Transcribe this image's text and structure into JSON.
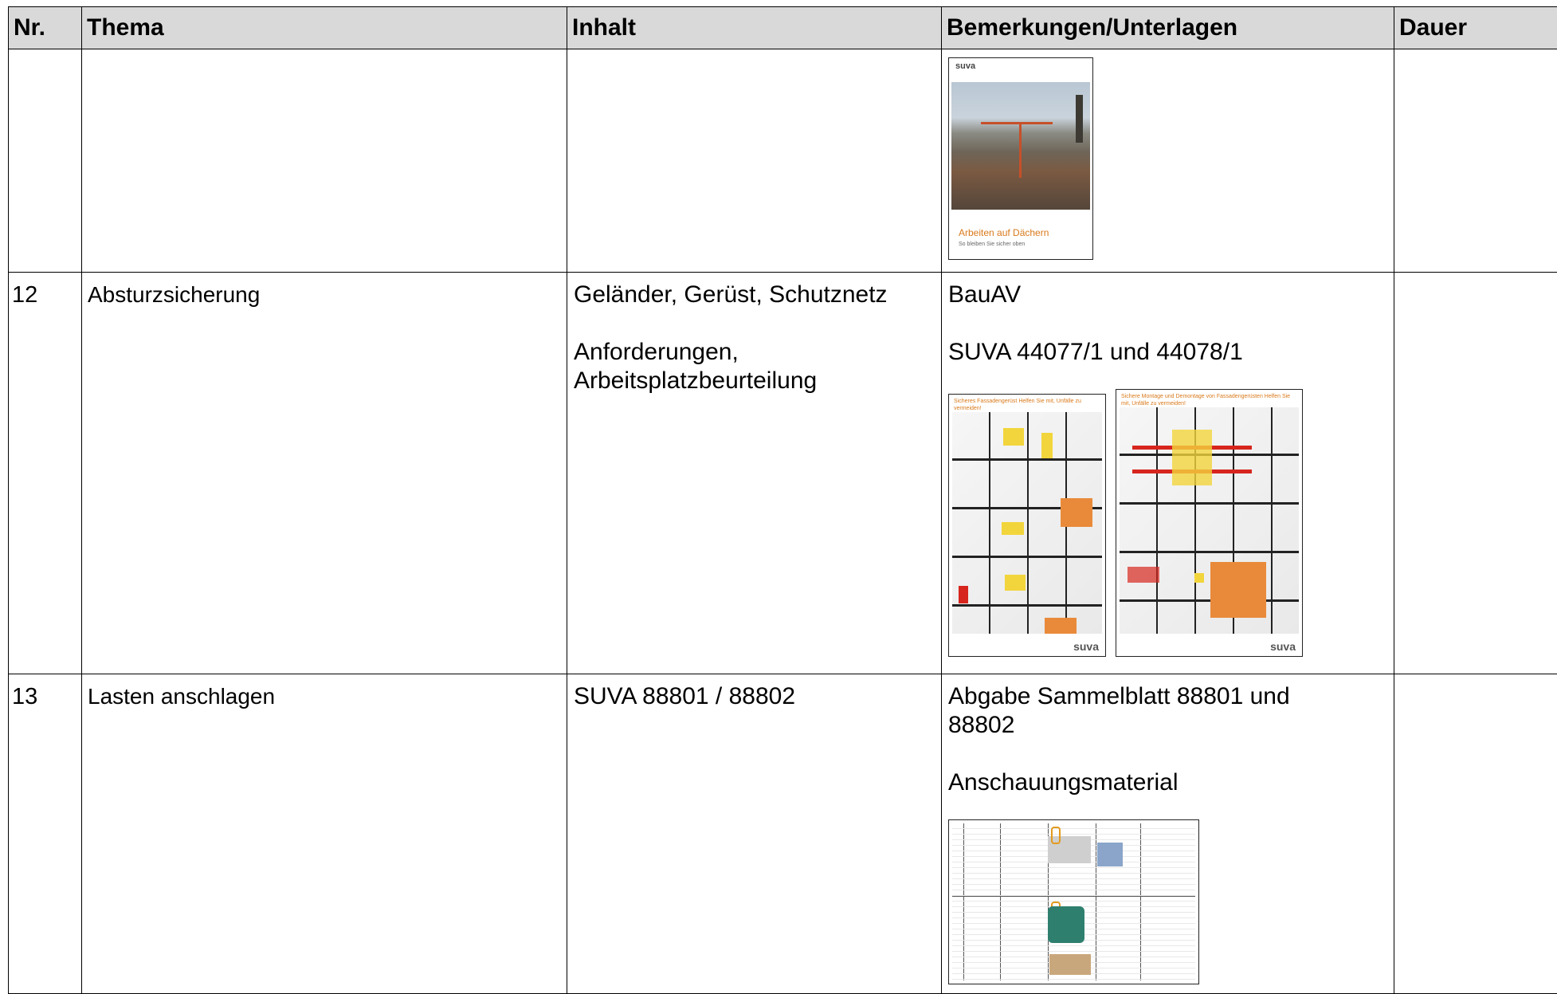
{
  "headers": {
    "nr": "Nr.",
    "thema": "Thema",
    "inhalt": "Inhalt",
    "bemerkungen": "Bemerkungen/Unterlagen",
    "dauer": "Dauer"
  },
  "rows": [
    {
      "nr": "",
      "thema": "",
      "inhalt": [],
      "bemerkungen": [],
      "doc_thumb": {
        "logo": "suva",
        "title": "Arbeiten auf Dächern",
        "subtitle": "So bleiben Sie sicher oben"
      }
    },
    {
      "nr": "12",
      "thema": "Absturzsicherung",
      "inhalt": [
        "Geländer, Gerüst, Schutznetz",
        "Anforderungen, Arbeitsplatzbeurteilung"
      ],
      "bemerkungen": [
        "BauAV",
        "SUVA 44077/1 und 44078/1"
      ],
      "posters": [
        {
          "header": "Sicheres Fassadengerüst Helfen Sie mit, Unfälle zu vermeiden!",
          "brand": "suva"
        },
        {
          "header": "Sichere Montage und Demontage von Fassadengerüsten Helfen Sie mit, Unfälle zu vermeiden!",
          "brand": "suva"
        }
      ]
    },
    {
      "nr": "13",
      "thema": "Lasten anschlagen",
      "inhalt": [
        "SUVA 88801 / 88802"
      ],
      "bemerkungen": [
        "Abgabe Sammelblatt 88801 und 88802",
        "Anschauungsmaterial"
      ]
    }
  ]
}
